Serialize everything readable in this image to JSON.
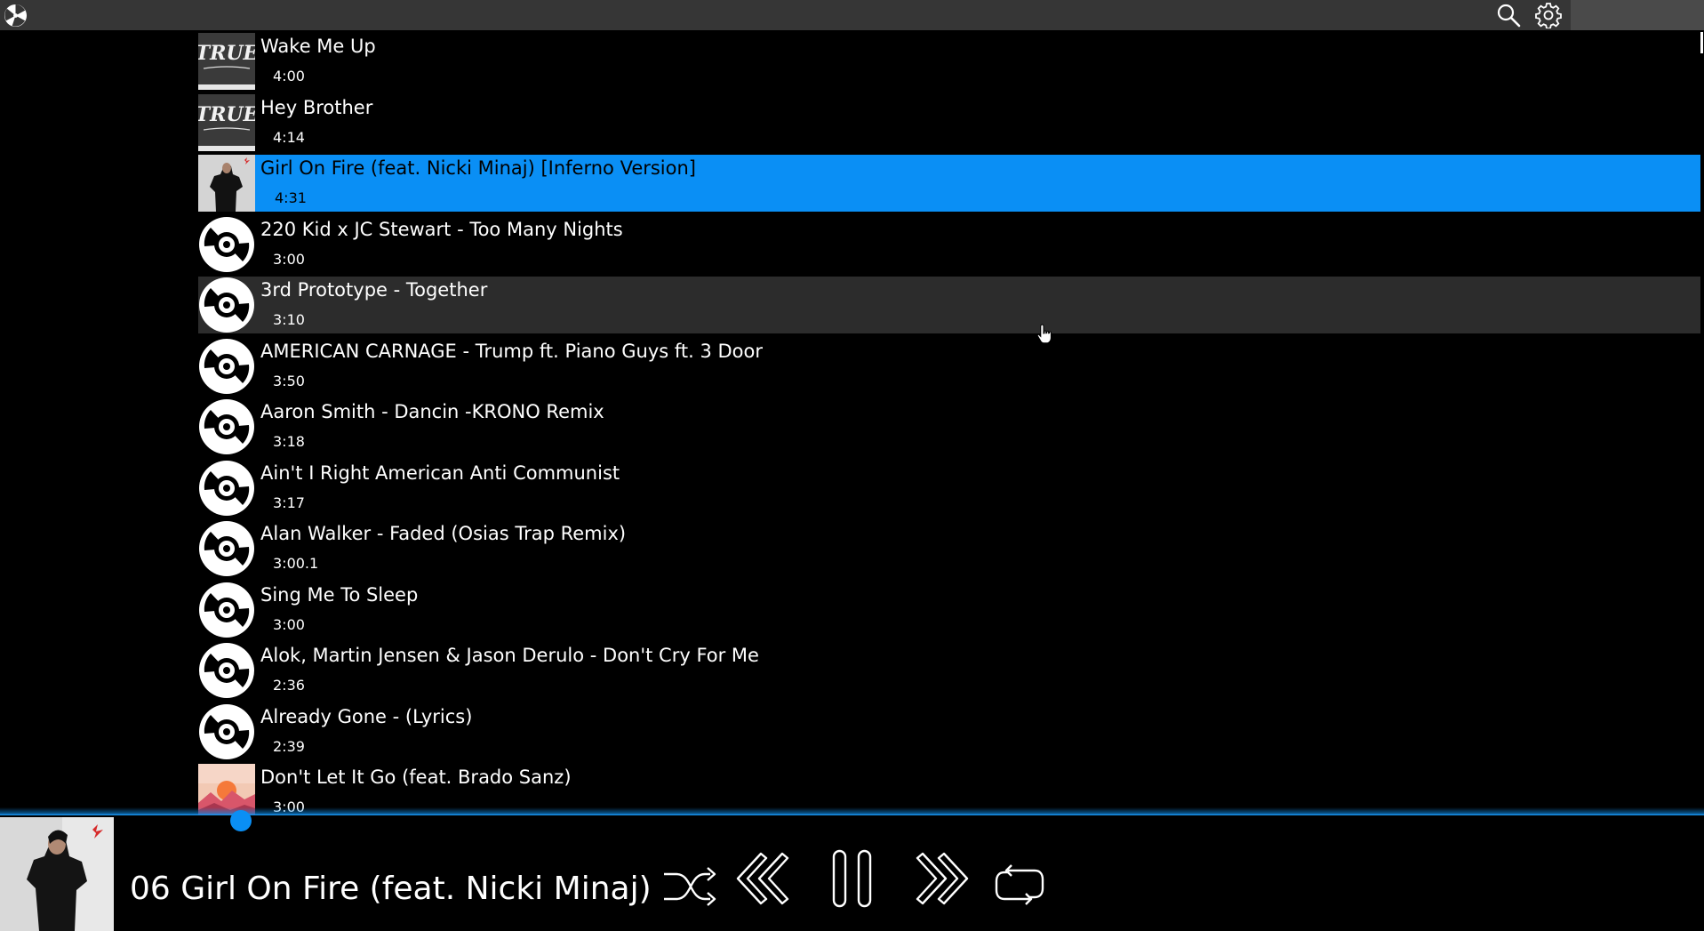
{
  "topbar": {
    "logo_icon": "pinwheel-logo-icon",
    "search_icon": "search-icon",
    "settings_icon": "gear-icon"
  },
  "tracks": [
    {
      "title": "Wake Me Up",
      "duration": "4:00",
      "art": "true-album-art"
    },
    {
      "title": "Hey Brother",
      "duration": "4:14",
      "art": "true-album-art"
    },
    {
      "title": "Girl On Fire (feat. Nicki Minaj) [Inferno Version]",
      "duration": "4:31",
      "art": "girl-on-fire-album-art",
      "state": "playing"
    },
    {
      "title": "220 Kid x JC Stewart - Too Many Nights",
      "duration": "3:00",
      "art": "vinyl-disc-icon"
    },
    {
      "title": "3rd Prototype - Together",
      "duration": "3:10",
      "art": "vinyl-disc-icon",
      "state": "hover"
    },
    {
      "title": "AMERICAN CARNAGE - Trump ft. Piano Guys ft. 3 Door",
      "duration": "3:50",
      "art": "vinyl-disc-icon"
    },
    {
      "title": "Aaron Smith - Dancin -KRONO Remix",
      "duration": "3:18",
      "art": "vinyl-disc-icon"
    },
    {
      "title": "Ain't I Right American Anti Communist",
      "duration": "3:17",
      "art": "vinyl-disc-icon"
    },
    {
      "title": "Alan Walker - Faded (Osias Trap Remix)",
      "duration": "3:00.1",
      "art": "vinyl-disc-icon"
    },
    {
      "title": "Sing Me To Sleep",
      "duration": "3:00",
      "art": "vinyl-disc-icon"
    },
    {
      "title": "Alok, Martin Jensen & Jason Derulo - Don't Cry For Me",
      "duration": "2:36",
      "art": "vinyl-disc-icon"
    },
    {
      "title": "Already Gone - (Lyrics)",
      "duration": "2:39",
      "art": "vinyl-disc-icon"
    },
    {
      "title": "Don't Let It Go (feat. Brado Sanz)",
      "duration": "3:00",
      "art": "sunset-album-art"
    }
  ],
  "player": {
    "now_playing": "06 Girl On Fire (feat. Nicki Minaj)",
    "progress_fraction": 0.0,
    "controls": [
      "shuffle-icon",
      "previous-icon",
      "pause-icon",
      "next-icon",
      "repeat-icon"
    ]
  },
  "colors": {
    "accent": "#0a8ff5",
    "topbar": "#363636",
    "hover_row": "#2c2c2c",
    "background": "#000000"
  }
}
